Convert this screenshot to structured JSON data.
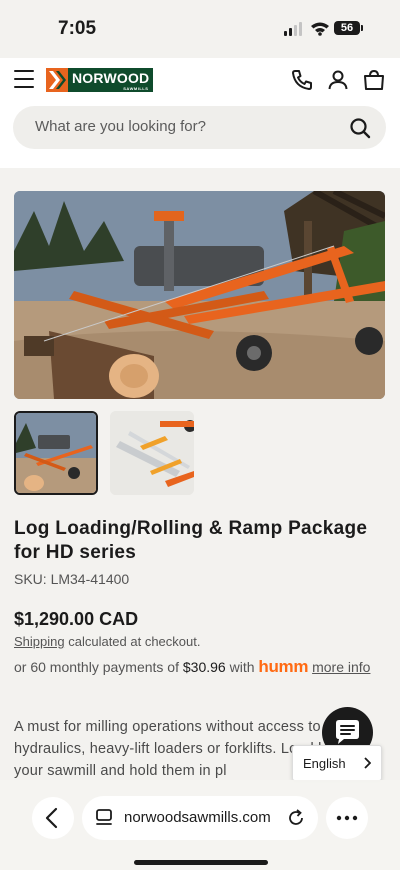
{
  "status": {
    "time": "7:05",
    "battery": "56"
  },
  "header": {
    "brand_name": "NORWOOD",
    "brand_sub": "SAWMILLS",
    "search_placeholder": "What are you looking for?"
  },
  "product": {
    "title": "Log Loading/Rolling & Ramp Package for HD series",
    "sku": "SKU: LM34-41400",
    "price": "$1,290.00 CAD",
    "shipping_link": "Shipping",
    "shipping_text": " calculated at checkout.",
    "payments_prefix": "or 60 monthly payments of ",
    "payments_amount": "$30.96",
    "payments_with": " with ",
    "payments_brand": "humm",
    "more_info": "more info",
    "description": "A must for milling operations without access to hydraulics, heavy-lift loaders or forklifts. Load logs onto your sawmill and hold them in pl"
  },
  "language": {
    "selected": "English"
  },
  "browser": {
    "url": "norwoodsawmills.com"
  },
  "colors": {
    "brand_orange": "#e8641e",
    "brand_green": "#0f4b2c",
    "humm_orange": "#ff6a13"
  }
}
